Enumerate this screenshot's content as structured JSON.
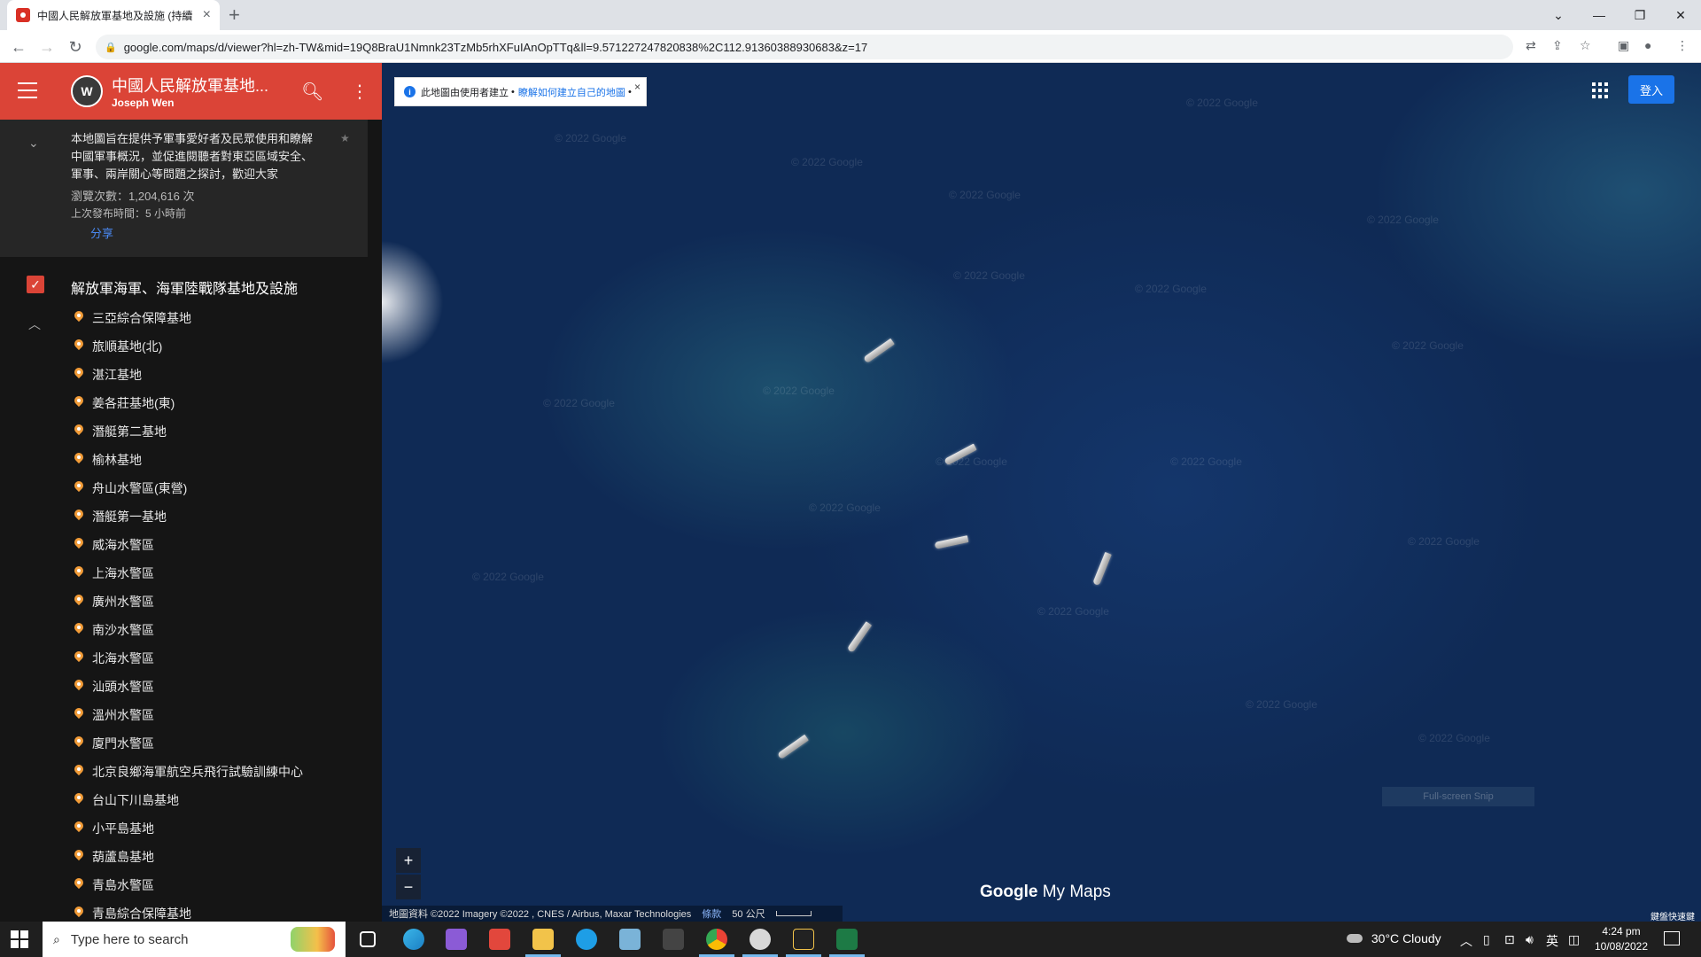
{
  "browser": {
    "tab_title": "中國人民解放軍基地及設施 (持續",
    "url": "google.com/maps/d/viewer?hl=zh-TW&mid=19Q8BraU1Nmnk23TzMb5rhXFuIAnOpTTq&ll=9.571227247820838%2C112.91360388930683&z=17"
  },
  "sidebar": {
    "map_title": "中國人民解放軍基地...",
    "author": "Joseph Wen",
    "avatar_text": "W",
    "description": "本地圖旨在提供予軍事愛好者及民眾使用和瞭解中國軍事概況，並促進閱聽者對東亞區域安全、軍事、兩岸關心等問題之探討，歡迎大家",
    "views": "瀏覽次數：1,204,616 次",
    "updated": "上次發布時間：5 小時前",
    "share_label": "分享",
    "layer_title": "解放軍海軍、海軍陸戰隊基地及設施",
    "items": [
      "三亞綜合保障基地",
      "旅順基地(北)",
      "湛江基地",
      "姜各莊基地(東)",
      "潛艇第二基地",
      "榆林基地",
      "舟山水警區(東營)",
      "潛艇第一基地",
      "威海水警區",
      "上海水警區",
      "廣州水警區",
      "南沙水警區",
      "北海水警區",
      "汕頭水警區",
      "溫州水警區",
      "廈門水警區",
      "北京良鄉海軍航空兵飛行試驗訓練中心",
      "台山下川島基地",
      "小平島基地",
      "葫蘆島基地",
      "青島水警區",
      "青島綜合保障基地"
    ]
  },
  "map": {
    "notice_text": "此地圖由使用者建立",
    "notice_link": "瞭解如何建立自己的地圖",
    "signin_label": "登入",
    "watermark": "© 2022 Google",
    "zoom_in": "+",
    "zoom_out": "−",
    "logo_google": "Google",
    "logo_mymaps": "My Maps",
    "attribution": "地圖資料 ©2022 Imagery ©2022 , CNES / Airbus, Maxar Technologies",
    "terms_label": "條款",
    "scale_label": "50 公尺",
    "snip_label": "Full-screen Snip",
    "corner_label": "鍵盤快速鍵"
  },
  "taskbar": {
    "search_placeholder": "Type here to search",
    "temperature": "30°C",
    "weather": "Cloudy",
    "ime": "英",
    "time": "4:24 pm",
    "date": "10/08/2022"
  }
}
